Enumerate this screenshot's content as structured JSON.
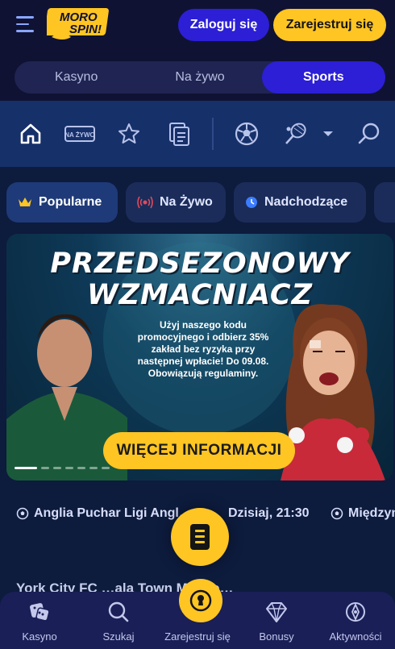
{
  "header": {
    "login_label": "Zaloguj się",
    "register_label": "Zarejestruj się",
    "logo_text_top": "MORO",
    "logo_text_bottom": "SPIN!"
  },
  "tabs": [
    {
      "label": "Kasyno",
      "active": false
    },
    {
      "label": "Na żywo",
      "active": false
    },
    {
      "label": "Sports",
      "active": true
    }
  ],
  "sport_nav": {
    "live_badge": "NA ŻYWO",
    "icons": [
      "home-icon",
      "live-tv-icon",
      "star-icon",
      "betslip-icon",
      "football-icon",
      "tennis-icon",
      "chevron-down-icon",
      "search-icon"
    ]
  },
  "chips": [
    {
      "label": "Popularne",
      "icon": "crown-icon",
      "active": true
    },
    {
      "label": "Na Żywo",
      "icon": "live-broadcast-icon",
      "active": false
    },
    {
      "label": "Nadchodzące",
      "icon": "clock-icon",
      "active": false
    }
  ],
  "banner": {
    "title_line1": "PRZEDSEZONOWY",
    "title_line2": "WZMACNIACZ",
    "text": "Użyj naszego kodu promocyjnego i odbierz 35% zakład bez ryzyka przy następnej wpłacie! Do 09.08. Obowiązują regulaminy.",
    "button_label": "WIĘCEJ INFORMACJI",
    "slide_count": 7,
    "active_slide": 0
  },
  "events": {
    "league": "Anglia Puchar Ligi Angl…",
    "time": "Dzisiaj, 21:30",
    "next_league": "Międzyn…",
    "teams_line": "York City FC          …ala Town    Middle…"
  },
  "bottom_bar": [
    {
      "label": "Kasyno",
      "icon": "dice-icon"
    },
    {
      "label": "Szukaj",
      "icon": "search-icon"
    },
    {
      "label": "Zarejestruj się",
      "icon": "keyhole-icon"
    },
    {
      "label": "Bonusy",
      "icon": "diamond-icon"
    },
    {
      "label": "Aktywności",
      "icon": "compass-icon"
    }
  ],
  "colors": {
    "accent_yellow": "#ffc523",
    "accent_blue": "#2c1fd6",
    "header_bg": "#101233",
    "nav_bg": "#16306a",
    "page_bg": "#0d1b3d"
  }
}
